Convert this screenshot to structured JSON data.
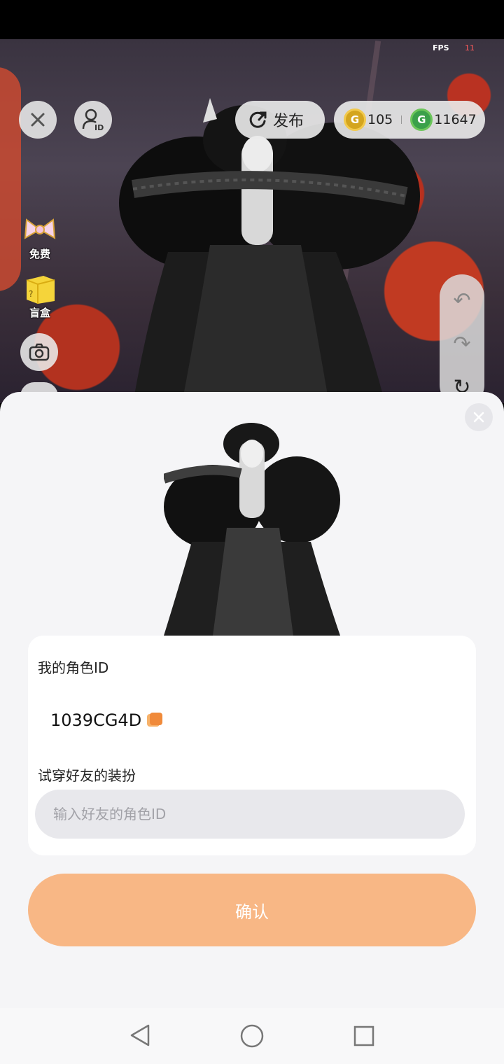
{
  "status_bar": {
    "fps_label": "FPS",
    "fps_value": "11"
  },
  "top_bar": {
    "close_icon": "close-icon",
    "profile_id_icon": "profile-id-icon",
    "publish_label": "发布",
    "currency": [
      {
        "icon": "gold-coin-icon",
        "symbol": "G",
        "amount": "105",
        "color": "#d4a51e"
      },
      {
        "icon": "green-coin-icon",
        "symbol": "G",
        "amount": "11647",
        "color": "#3aa04a"
      }
    ]
  },
  "side_menu": [
    {
      "label": "免费",
      "icon": "bow-gift-icon"
    },
    {
      "label": "盲盒",
      "icon": "blind-box-icon"
    },
    {
      "label": "",
      "icon": "camera-icon"
    }
  ],
  "sheet": {
    "my_id_label": "我的角色ID",
    "my_id_value": "1039CG4D",
    "try_on_label": "试穿好友的装扮",
    "friend_input_placeholder": "输入好友的角色ID",
    "friend_input_value": "",
    "confirm_label": "确认"
  },
  "colors": {
    "accent": "#f8b785",
    "copy_icon": "#f08a3a",
    "sheet_bg": "#f5f5f7",
    "input_bg": "#e8e8ec"
  }
}
